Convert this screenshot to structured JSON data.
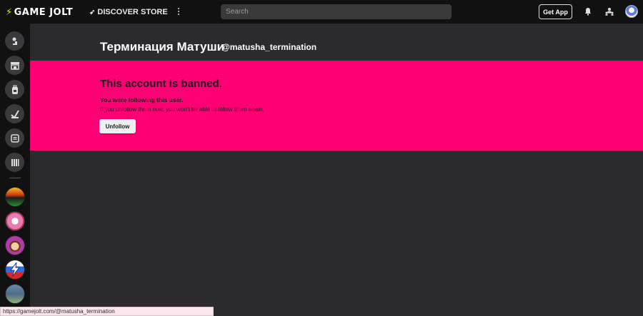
{
  "topbar": {
    "logo_text": "GAME JOLT",
    "discover_label": "DISCOVER",
    "store_label": "STORE",
    "search_placeholder": "Search",
    "get_app_label": "Get App"
  },
  "sidebar": {
    "buttons": [
      "home-icon",
      "store-icon",
      "backpack-icon",
      "quests-icon",
      "creator-icon",
      "library-icon"
    ],
    "avatar_colors": [
      "#3a6b1f",
      "#e67fb1",
      "#b33aa8",
      "#2d6de0",
      "#4d6a8a"
    ]
  },
  "profile": {
    "display_name": "Терминация Матуши",
    "username": "@matusha_termination"
  },
  "banned": {
    "title": "This account is banned.",
    "following": "You were following this user.",
    "note": "If you unfollow them now, you won't be able to follow them again.",
    "unfollow_label": "Unfollow",
    "background": "#ff0074"
  },
  "statusbar": {
    "url": "https://gamejolt.com/@matusha_termination"
  }
}
